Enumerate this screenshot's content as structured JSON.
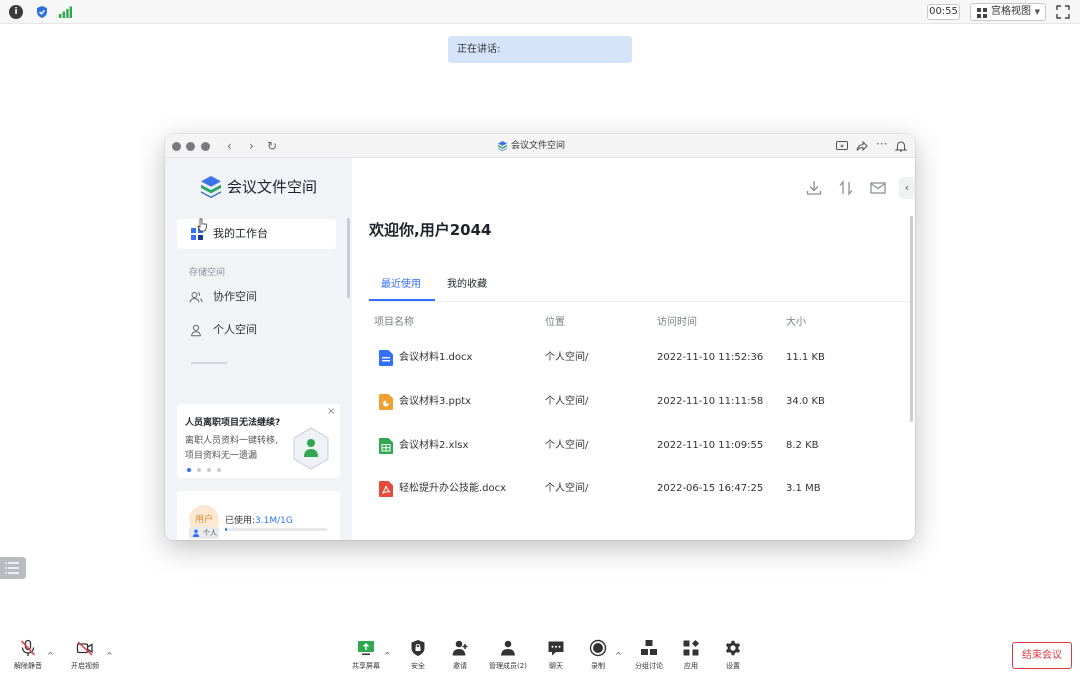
{
  "topbar": {
    "timer": "00:55",
    "view_label": "宫格视图",
    "icons": [
      "info-icon",
      "shield-icon",
      "signal-icon",
      "fullscreen-icon"
    ]
  },
  "speaking": "正在讲话:",
  "window": {
    "title": "会议文件空间",
    "sidebar": {
      "app_name": "会议文件空间",
      "workbench": "我的工作台",
      "section": "存储空间",
      "items": [
        {
          "label": "协作空间",
          "icon": "people-icon"
        },
        {
          "label": "个人空间",
          "icon": "person-icon"
        }
      ],
      "promo": {
        "title": "人员离职项目无法继续?",
        "line1": "离职人员资料一键转移,",
        "line2": "项目资料无一遗漏",
        "close": "×"
      },
      "storage": {
        "avatar": "用户",
        "badge": "个人",
        "label": "已使用:",
        "value": "3.1M/1G",
        "usage": 0.003
      }
    },
    "main": {
      "welcome": "欢迎你,用户2044",
      "tabs": [
        "最近使用",
        "我的收藏"
      ],
      "active_tab": 0,
      "columns": [
        "项目名称",
        "位置",
        "访问时间",
        "大小"
      ],
      "rows": [
        {
          "name": "会议材料1.docx",
          "location": "个人空间/",
          "time": "2022-11-10 11:52:36",
          "size": "11.1 KB",
          "type": "docx"
        },
        {
          "name": "会议材料3.pptx",
          "location": "个人空间/",
          "time": "2022-11-10 11:11:58",
          "size": "34.0 KB",
          "type": "pptx"
        },
        {
          "name": "会议材料2.xlsx",
          "location": "个人空间/",
          "time": "2022-11-10 11:09:55",
          "size": "8.2 KB",
          "type": "xlsx"
        },
        {
          "name": "轻松提升办公技能.docx",
          "location": "个人空间/",
          "time": "2022-06-15 16:47:25",
          "size": "3.1 MB",
          "type": "pdf"
        }
      ]
    }
  },
  "toolbar": {
    "left": [
      {
        "label": "解除静音",
        "icon": "mic-muted-icon"
      },
      {
        "label": "开启视频",
        "icon": "video-off-icon"
      }
    ],
    "center": [
      {
        "label": "共享屏幕",
        "icon": "share-screen-icon"
      },
      {
        "label": "安全",
        "icon": "security-icon"
      },
      {
        "label": "邀请",
        "icon": "invite-icon"
      },
      {
        "label": "管理成员(2)",
        "icon": "members-icon"
      },
      {
        "label": "聊天",
        "icon": "chat-icon"
      },
      {
        "label": "录制",
        "icon": "record-icon"
      },
      {
        "label": "分组讨论",
        "icon": "breakout-icon"
      },
      {
        "label": "应用",
        "icon": "apps-icon"
      },
      {
        "label": "设置",
        "icon": "settings-icon"
      }
    ],
    "end": "结束会议"
  },
  "colors": {
    "accent": "#3370ff",
    "danger": "#e0383e",
    "docx": "#3370ff",
    "pptx": "#f0a030",
    "xlsx": "#2fa84f",
    "pdf": "#e84a3a"
  }
}
